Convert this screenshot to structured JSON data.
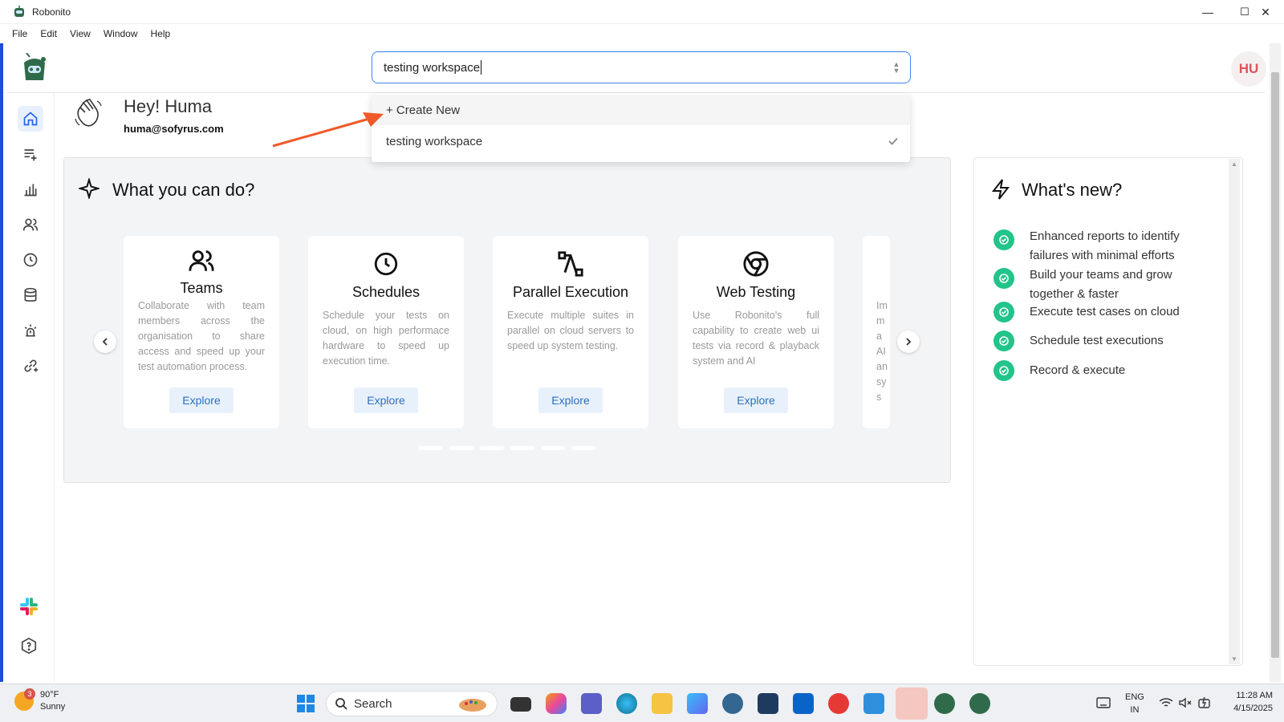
{
  "window": {
    "title": "Robonito",
    "minimize": "—",
    "maximize": "☐",
    "close": "✕"
  },
  "menu": [
    "File",
    "Edit",
    "View",
    "Window",
    "Help"
  ],
  "header": {
    "workspace_value": "testing workspace",
    "avatar_initials": "HU"
  },
  "dropdown": {
    "items": [
      "+ Create New",
      "testing workspace"
    ]
  },
  "greeting": {
    "title": "Hey! Huma",
    "email": "huma@sofyrus.com"
  },
  "what_you_can_do": {
    "title": "What you can do?",
    "cards": [
      {
        "title": "Teams",
        "desc": "Collaborate with team members across the organisation to share access and speed up your test automation process.",
        "button": "Explore",
        "icon": "users-icon"
      },
      {
        "title": "Schedules",
        "desc": "Schedule your tests on cloud, on high performace hardware to speed up execution time.",
        "button": "Explore",
        "icon": "clock-icon"
      },
      {
        "title": "Parallel Execution",
        "desc": "Execute multiple suites in parallel on cloud servers to speed up system testing.",
        "button": "Explore",
        "icon": "parallel-icon"
      },
      {
        "title": "Web Testing",
        "desc": "Use Robonito's full capability to create web ui tests via record & playback system and AI",
        "button": "Explore",
        "icon": "chrome-icon"
      }
    ],
    "partial_card_text": "Im ma AI an sys"
  },
  "whats_new": {
    "title": "What's new?",
    "items": [
      "Enhanced reports to identify failures with minimal efforts",
      "Build your teams and grow together & faster",
      "Execute test cases on cloud",
      "Schedule test executions",
      "Record & execute"
    ]
  },
  "taskbar": {
    "weather_temp": "90°F",
    "weather_desc": "Sunny",
    "weather_badge": "3",
    "search_label": "Search",
    "lang_line1": "ENG",
    "lang_line2": "IN",
    "time": "11:28 AM",
    "date": "4/15/2025"
  },
  "colors": {
    "accent": "#3b82f6",
    "success": "#22c48a",
    "avatar_text": "#e0525a",
    "explore_text": "#2b6fbf",
    "arrow": "#f05a28"
  }
}
